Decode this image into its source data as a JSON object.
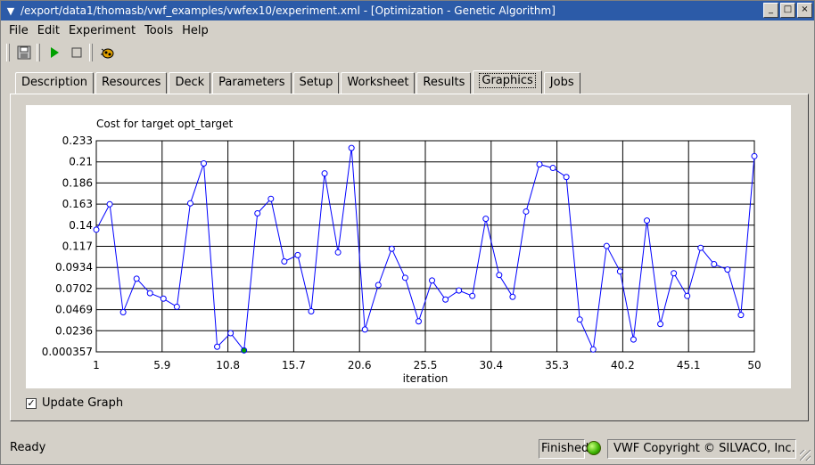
{
  "window": {
    "title": "/export/data1/thomasb/vwf_examples/vwfex10/experiment.xml - [Optimization - Genetic Algorithm]",
    "controls": [
      "_",
      "□",
      "×"
    ]
  },
  "menu": {
    "items": [
      "File",
      "Edit",
      "Experiment",
      "Tools",
      "Help"
    ]
  },
  "toolbar": {
    "icons": [
      "save-icon",
      "play-icon",
      "stop-icon",
      "bug-icon"
    ]
  },
  "tabs": [
    "Description",
    "Resources",
    "Deck",
    "Parameters",
    "Setup",
    "Worksheet",
    "Results",
    "Graphics",
    "Jobs"
  ],
  "active_tab": "Graphics",
  "chart_data": {
    "type": "line",
    "title": "Cost for target opt_target",
    "xlabel": "iteration",
    "ylabel": "",
    "xlim": [
      1,
      50
    ],
    "ylim": [
      0.000357,
      0.233
    ],
    "x_ticks": [
      "1",
      "5.9",
      "10.8",
      "15.7",
      "20.6",
      "25.5",
      "30.4",
      "35.3",
      "40.2",
      "45.1",
      "50"
    ],
    "y_ticks": [
      "0.233",
      "0.21",
      "0.186",
      "0.163",
      "0.14",
      "0.117",
      "0.0934",
      "0.0702",
      "0.0469",
      "0.0236",
      "0.000357"
    ],
    "grid": true,
    "marker_color": "#0000ff",
    "best_marker_color": "#00a000",
    "best_index": 11,
    "x": [
      1,
      2,
      3,
      4,
      5,
      6,
      7,
      8,
      9,
      10,
      11,
      12,
      13,
      14,
      15,
      16,
      17,
      18,
      19,
      20,
      21,
      22,
      23,
      24,
      25,
      26,
      27,
      28,
      29,
      30,
      31,
      32,
      33,
      34,
      35,
      36,
      37,
      38,
      39,
      40,
      41,
      42,
      43,
      44,
      45,
      46,
      47,
      48,
      49,
      50
    ],
    "values": [
      0.135,
      0.163,
      0.044,
      0.081,
      0.065,
      0.059,
      0.05,
      0.164,
      0.208,
      0.006,
      0.021,
      0.002,
      0.153,
      0.169,
      0.1,
      0.107,
      0.045,
      0.197,
      0.11,
      0.225,
      0.025,
      0.074,
      0.114,
      0.082,
      0.034,
      0.079,
      0.058,
      0.068,
      0.062,
      0.147,
      0.085,
      0.061,
      0.155,
      0.207,
      0.203,
      0.193,
      0.036,
      0.003,
      0.117,
      0.089,
      0.014,
      0.145,
      0.031,
      0.087,
      0.062,
      0.115,
      0.097,
      0.091,
      0.041,
      0.216
    ]
  },
  "update_graph": {
    "label": "Update Graph",
    "checked": "✓"
  },
  "status": {
    "text": "Ready",
    "state": "Finished",
    "copyright": "VWF Copyright ©  SILVACO, Inc."
  }
}
